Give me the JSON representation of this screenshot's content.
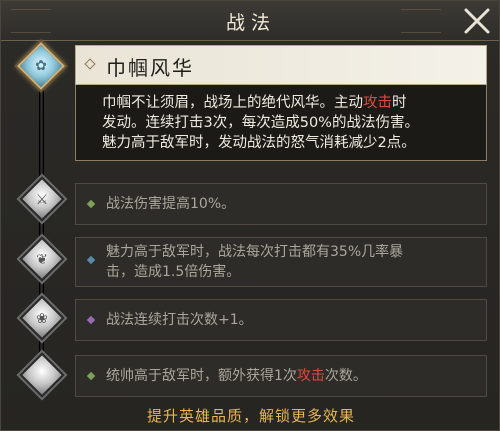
{
  "window": {
    "title": "战法"
  },
  "skill": {
    "name": "巾帼风华",
    "desc_line1": "巾帼不让须眉，战场上的绝代风华。主动",
    "desc_highlight": "攻击",
    "desc_line1_end": "时",
    "desc_line2": "发动。连续打击3次，每次造成50%的战法伤害。",
    "desc_line3": "魅力高于敌军时，发动战法的怒气消耗减少2点。"
  },
  "upgrades": [
    {
      "text": "战法伤害提高10%。",
      "icon": "sword-emblem-icon"
    },
    {
      "text_line1": "魅力高于敌军时，战法每次打击都有35%几率暴",
      "text_line2": "击，造成1.5倍伤害。",
      "icon": "dragon-emblem-icon"
    },
    {
      "text": "战法连续打击次数+1。",
      "icon": "lotus-emblem-icon"
    },
    {
      "text_pre": "统帅高于敌军时，额外获得1次",
      "text_highlight": "攻击",
      "text_post": "次数。",
      "icon": "blank-emblem-icon"
    }
  ],
  "footer": {
    "hint": "提升英雄品质，解锁更多效果"
  },
  "colors": {
    "highlight": "#e04a3a",
    "footer_text": "#e6b64f",
    "bullet_colors": [
      "#7fa05a",
      "#5a8aa8",
      "#9a6ab0",
      "#7fa05a"
    ]
  }
}
